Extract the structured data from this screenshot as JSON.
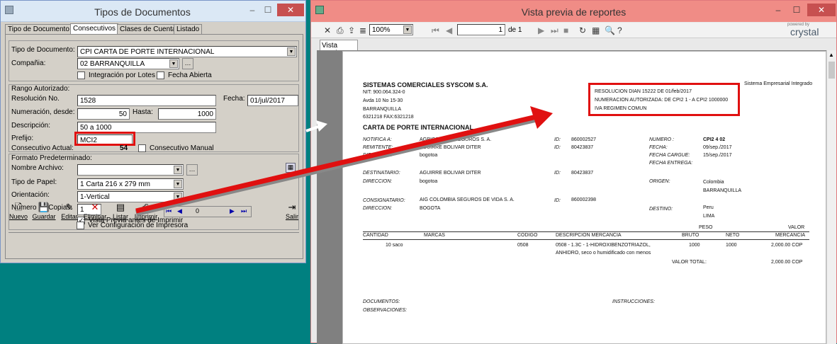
{
  "left": {
    "title": "Tipos de Documentos",
    "tabs": [
      "Tipo de Documento",
      "Consecutivos",
      "Clases de Cuentas",
      "Listado"
    ],
    "tipo_documento_label": "Tipo de Documento:",
    "tipo_documento_value": "CPI  CARTA DE PORTE INTERNACIONAL",
    "compania_label": "Compañia:",
    "compania_value": "02  BARRANQUILLA",
    "integracion_label": "Integración por Lotes",
    "fecha_abierta_label": "Fecha Abierta",
    "rango_title": "Rango Autorizado:",
    "resolucion_label": "Resolución No.",
    "resolucion_value": "1528",
    "fecha_label": "Fecha:",
    "fecha_value": "01/jul/2017",
    "numeracion_label": "Numeración, desde:",
    "numeracion_value": "50",
    "hasta_label": "Hasta:",
    "hasta_value": "1000",
    "descripcion_label": "Descripción:",
    "descripcion_value": "50 a 1000",
    "prefijo_label": "Prefijo:",
    "prefijo_value": "MCI2",
    "consecutivo_label": "Consecutivo Actual:",
    "consecutivo_value": "54",
    "consecutivo_manual_label": "Consecutivo Manual",
    "formato_title": "Formato Predeterminado:",
    "nombre_archivo_label": "Nombre Archivo:",
    "tipo_papel_label": "Tipo de Papel:",
    "tipo_papel_value": "1  Carta 216 x 279 mm",
    "orientacion_label": "Orientación:",
    "orientacion_value": "1-Vertical",
    "copias_label": "Número de Copias:",
    "copias_value": "1",
    "vista_previa_label": "Vista Previa antes de Imprimir",
    "ver_config_label": "Ver Configuración de Impresora",
    "buttons": {
      "nuevo": "Nuevo",
      "guardar": "Guardar",
      "editar": "Editar",
      "eliminar": "Eliminar",
      "listar": "Listar",
      "imprimir": "Imprimir",
      "salir": "Salir"
    },
    "nav_value": "0"
  },
  "right": {
    "title": "Vista previa de reportes",
    "zoom": "100%",
    "page_current": "1",
    "page_of": "de 1",
    "brand_small": "powered by",
    "brand": "crystal",
    "tab": "Vista previa",
    "report": {
      "company": "SISTEMAS COMERCIALES SYSCOM S.A.",
      "sistema": "Sistema Empresarial Integrado",
      "nit": "NIT: 900.064.324-0",
      "address": "Avda 10 No 15-30",
      "city": "BARRANQUILLA",
      "phone": "6321218 FAX:6321218",
      "resol1": "RESOLUCION DIAN 15222 DE 01/feb/2017",
      "resol2": "NUMERACION AUTORIZADA: DE CPI2 1 - A CPI2 1000000",
      "resol3": "IVA REGIMEN COMUN",
      "doc_title": "CARTA DE PORTE INTERNACIONAL",
      "notifica_label": "NOTIFICA A:",
      "notifica": "AGRICOLA DE SEGUROS S. A.",
      "notifica_id": "860002527",
      "remitente_label": "REMITENTE:",
      "remitente": "AGUIRRE BOLIVAR DITER",
      "remitente_id": "80423837",
      "direccion_label": "DIRECCION:",
      "direccion1": "bogotoa",
      "destinatario_label": "DESTINATARIO:",
      "destinatario": "AGUIRRE BOLIVAR DITER",
      "destinatario_id": "80423837",
      "direccion2": "bogotoa",
      "consignatario_label": "CONSIGNATARIO:",
      "consignatario": "AIG COLOMBIA SEGUROS DE VIDA S. A.",
      "consignatario_id": "860002398",
      "direccion3": "BOGOTA",
      "id_label": "ID:",
      "numero_label": "NUMERO :",
      "numero": "CPI2  4  02",
      "fecha_label": "FECHA:",
      "fecha": "09/sep./2017",
      "fecha_cargue_label": "FECHA CARGUE:",
      "fecha_cargue": "15/sep./2017",
      "fecha_entrega_label": "FECHA ENTREGA:",
      "origen_label": "ORIGEN:",
      "origen1": "Colombia",
      "origen2": "BARRANQUILLA",
      "destino_label": "DESTINO:",
      "destino1": "Peru",
      "destino2": "LIMA",
      "peso": "PESO",
      "valor": "VALOR",
      "col_cantidad": "CANTIDAD",
      "col_marcas": "MARCAS",
      "col_codigo": "CODIGO",
      "col_descripcion": "DESCRIPCION MERCANCIA",
      "col_bruto": "BRUTO",
      "col_neto": "NETO",
      "col_mercancia": "MERCANCIA",
      "row_cantidad": "10  saco",
      "row_codigo": "0508",
      "row_desc1": "0508 - 1.3C - 1-HIDROXIBENZOTRIAZOL,",
      "row_desc2": "ANHIDRO, seco o humidificado con menos",
      "row_bruto": "1000",
      "row_neto": "1000",
      "row_valor": "2,000.00  COP",
      "valor_total_label": "VALOR TOTAL:",
      "valor_total": "2,000.00  COP",
      "documentos_label": "DOCUMENTOS:",
      "instrucciones_label": "INSTRUCCIONES:",
      "observaciones_label": "OBSERVACIONES:"
    }
  },
  "colors": {
    "accent_red": "#e01010",
    "desktop": "#008080",
    "titlebar_active": "#f08c86"
  }
}
